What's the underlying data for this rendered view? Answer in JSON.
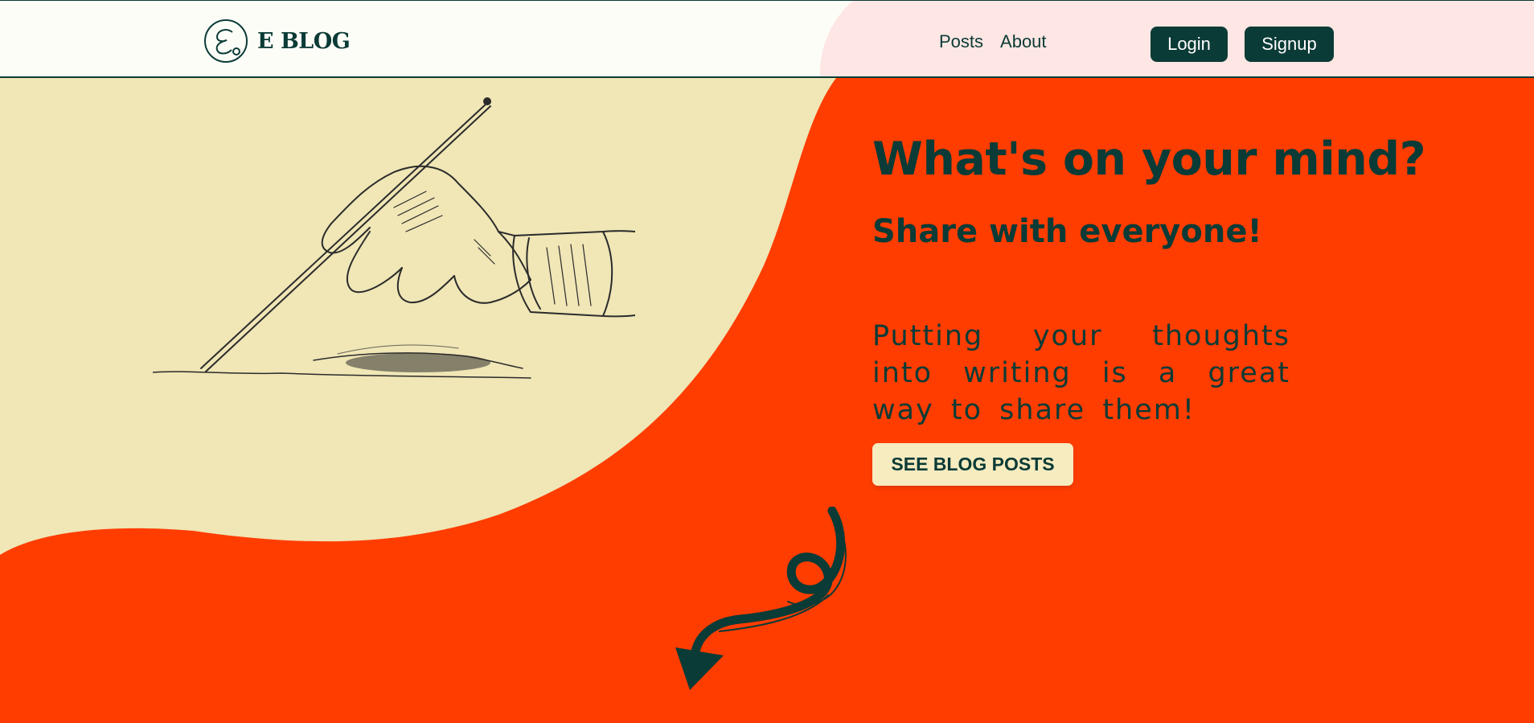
{
  "brand": {
    "name": "E BLOG",
    "logo_icon": "e-blog-logo-icon"
  },
  "nav": {
    "items": [
      {
        "label": "Posts"
      },
      {
        "label": "About"
      }
    ]
  },
  "auth": {
    "login_label": "Login",
    "signup_label": "Signup"
  },
  "hero": {
    "title": "What's on your mind?",
    "subtitle": "Share with everyone!",
    "body": "Putting your thoughts into writing is a great way to share them!",
    "cta_label": "SEE BLOG POSTS",
    "illustration_icon": "hand-writing-with-pen-icon",
    "arrow_icon": "curly-arrow-down-icon"
  },
  "colors": {
    "accent_orange": "#ff3d00",
    "cream": "#f0e6b6",
    "dark_teal": "#0b3b36",
    "button_cream": "#f7ebc0",
    "header_pink": "#fde6e3"
  }
}
